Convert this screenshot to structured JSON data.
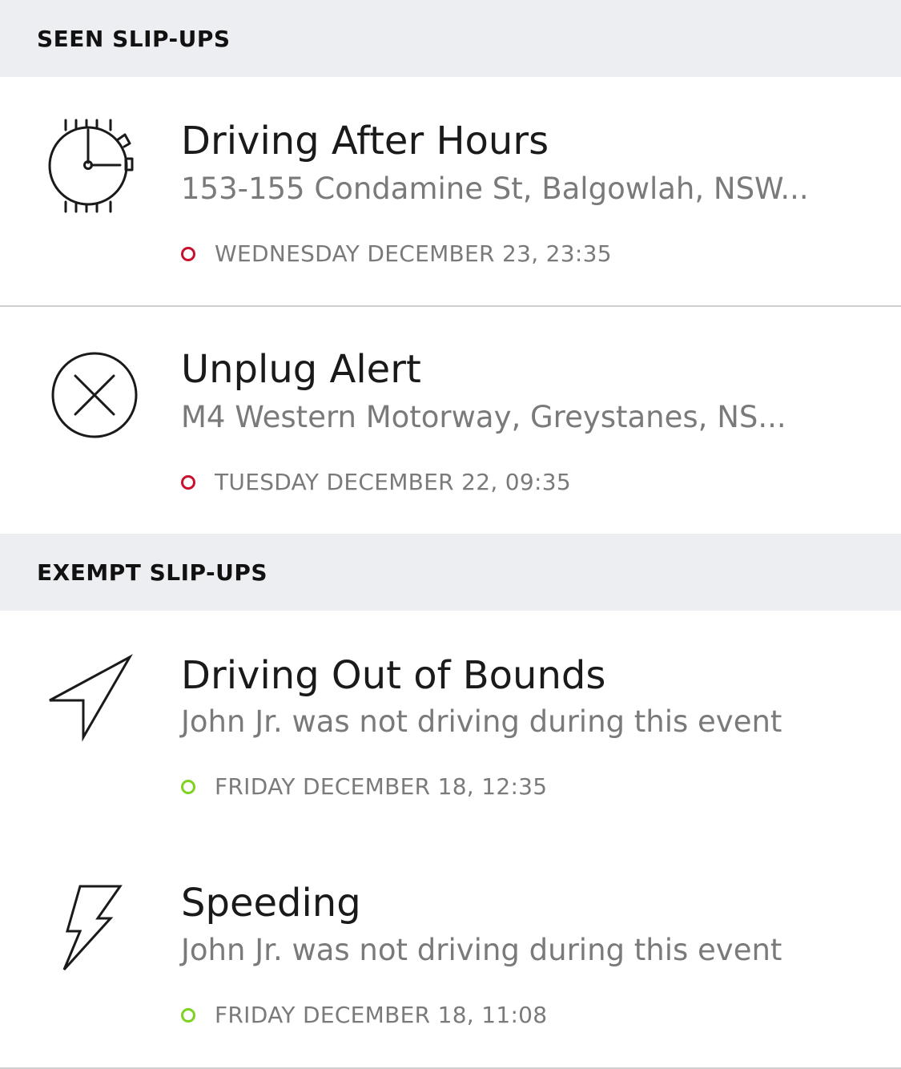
{
  "colors": {
    "header_bg": "#eceef1",
    "title": "#1a1a1a",
    "subtitle": "#7a7a7a",
    "status_red": "#c8102e",
    "status_green": "#7ed321"
  },
  "seen_section": {
    "header": "SEEN SLIP-UPS",
    "items": [
      {
        "icon": "clock-watch-icon",
        "title": "Driving After Hours",
        "subtitle": "153-155 Condamine St, Balgowlah, NSW...",
        "status_color": "red",
        "datetime": "WEDNESDAY DECEMBER 23, 23:35"
      },
      {
        "icon": "unplug-x-icon",
        "title": "Unplug Alert",
        "subtitle": "M4 Western Motorway, Greystanes, NS...",
        "status_color": "red",
        "datetime": "TUESDAY DECEMBER 22, 09:35"
      }
    ]
  },
  "exempt_section": {
    "header": "EXEMPT SLIP-UPS",
    "items": [
      {
        "icon": "navigation-arrow-icon",
        "title": "Driving Out of Bounds",
        "subtitle": "John Jr. was not driving during this event",
        "status_color": "green",
        "datetime": "FRIDAY DECEMBER 18, 12:35"
      },
      {
        "icon": "lightning-bolt-icon",
        "title": "Speeding",
        "subtitle": "John Jr. was not driving during this event",
        "status_color": "green",
        "datetime": "FRIDAY DECEMBER 18, 11:08"
      }
    ]
  }
}
